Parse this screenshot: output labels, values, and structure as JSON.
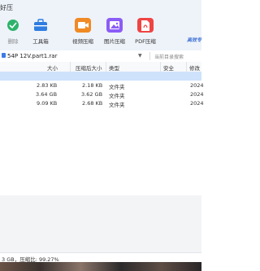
{
  "window": {
    "title_fragment": "好压"
  },
  "toolbar": {
    "brand": "高效专",
    "items": [
      {
        "label": "删除",
        "icon": "recycle-delete-icon",
        "color": "#2db36b"
      },
      {
        "label": "工具箱",
        "icon": "toolbox-icon",
        "color": "#2f7de1"
      },
      {
        "label": "视频压缩",
        "icon": "video-compress-icon",
        "color": "#f08a24"
      },
      {
        "label": "图片压缩",
        "icon": "image-compress-icon",
        "color": "#8b5cf6"
      },
      {
        "label": "PDF压缩",
        "icon": "pdf-compress-icon",
        "color": "#ef4444"
      }
    ]
  },
  "pathbar": {
    "path": "54P 12V.part1.rar",
    "search_placeholder": "当前目录搜索"
  },
  "columns": [
    "大小",
    "压缩后大小",
    "类型",
    "安全",
    "修改"
  ],
  "rows": [
    {
      "size": "2.83 KB",
      "packed": "2.18 KB",
      "type": "文件夹",
      "modified": "2024"
    },
    {
      "size": "3.64 GB",
      "packed": "3.62 GB",
      "type": "文件夹",
      "modified": "2024"
    },
    {
      "size": "9.09 KB",
      "packed": "2.68 KB",
      "type": "文件夹",
      "modified": "2024"
    }
  ],
  "status": {
    "text": "3 GB，压缩比: 99.27%"
  }
}
